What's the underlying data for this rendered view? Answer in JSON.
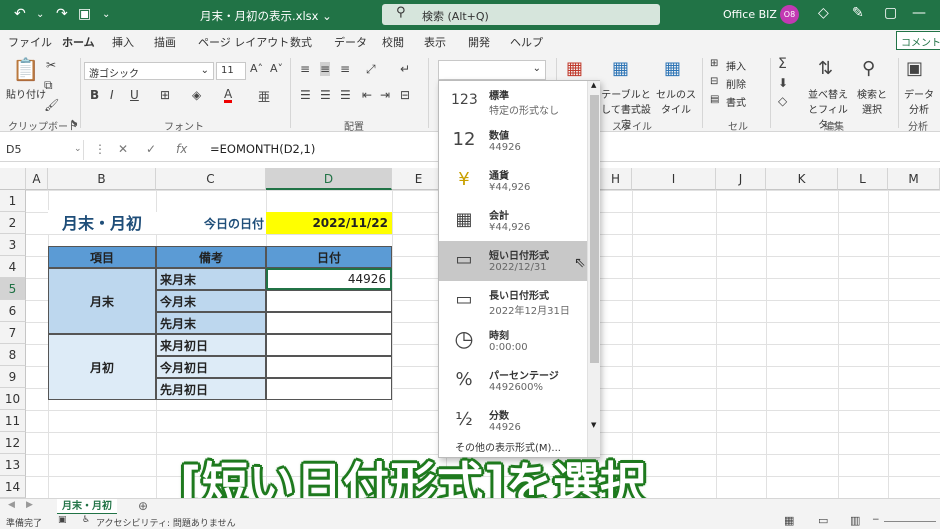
{
  "titlebar": {
    "filename": "月末・月初の表示.xlsx ⌄",
    "search": "検索 (Alt+Q)",
    "user": "Office BIZ",
    "initials": "O8"
  },
  "menu": [
    "ファイル",
    "ホーム",
    "挿入",
    "描画",
    "ページ レイアウト",
    "数式",
    "データ",
    "校閲",
    "表示",
    "開発",
    "ヘルプ"
  ],
  "comment_btn": "コメント",
  "ribbon": {
    "paste": "貼り付け",
    "font_name": "游ゴシック",
    "font_size": "11",
    "groups": {
      "clipboard": "クリップボード",
      "font": "フォント",
      "align": "配置",
      "style": "スタイル",
      "cells": "セル",
      "edit": "編集",
      "analysis": "分析"
    },
    "table_fmt": "テーブルとして書式設定",
    "cell_style": "セルのスタイル",
    "insert": "挿入",
    "delete": "削除",
    "format": "書式",
    "sort_filter": "並べ替えとフィルター",
    "find": "検索と選択",
    "data_analysis": "データ分析"
  },
  "formulabar": {
    "namebox": "D5",
    "formula": "=EOMONTH(D2,1)"
  },
  "columns": [
    "A",
    "B",
    "C",
    "D",
    "E",
    "F",
    "G",
    "H",
    "I",
    "J",
    "K",
    "L",
    "M"
  ],
  "rows": [
    "1",
    "2",
    "3",
    "4",
    "5",
    "6",
    "7",
    "8",
    "9",
    "10",
    "11",
    "12",
    "13",
    "14"
  ],
  "sheet": {
    "title": "月末・月初",
    "today_label": "今日の日付",
    "today_value": "2022/11/22",
    "headers": [
      "項目",
      "備考",
      "日付"
    ],
    "group1": "月末",
    "group2": "月初",
    "notes": [
      "来月末",
      "今月末",
      "先月末",
      "来月初日",
      "今月初日",
      "先月初日"
    ],
    "d5": "44926"
  },
  "dropdown": {
    "items": [
      {
        "icon": "123",
        "label": "標準",
        "sample": "特定の形式なし"
      },
      {
        "icon": "12",
        "label": "数値",
        "sample": "44926"
      },
      {
        "icon": "¥",
        "label": "通貨",
        "sample": "¥44,926"
      },
      {
        "icon": "▦",
        "label": "会計",
        "sample": " ¥44,926"
      },
      {
        "icon": "▭",
        "label": "短い日付形式",
        "sample": "2022/12/31"
      },
      {
        "icon": "▭",
        "label": "長い日付形式",
        "sample": "2022年12月31日"
      },
      {
        "icon": "◷",
        "label": "時刻",
        "sample": "0:00:00"
      },
      {
        "icon": "%",
        "label": "パーセンテージ",
        "sample": "4492600%"
      },
      {
        "icon": "½",
        "label": "分数",
        "sample": "44926"
      }
    ],
    "more": "その他の表示形式(M)..."
  },
  "sheet_tab": "月末・月初",
  "status": {
    "ready": "準備完了",
    "accessibility": "アクセシビリティ: 問題ありません"
  },
  "caption": "[短い日付形式]を選択",
  "colors": {
    "excel_green": "#217346",
    "header_blue": "#5b9bd5",
    "light_blue": "#bdd7ee",
    "lighter_blue": "#ddebf7",
    "yellow": "#ffff00",
    "title_blue": "#1f4e79"
  }
}
